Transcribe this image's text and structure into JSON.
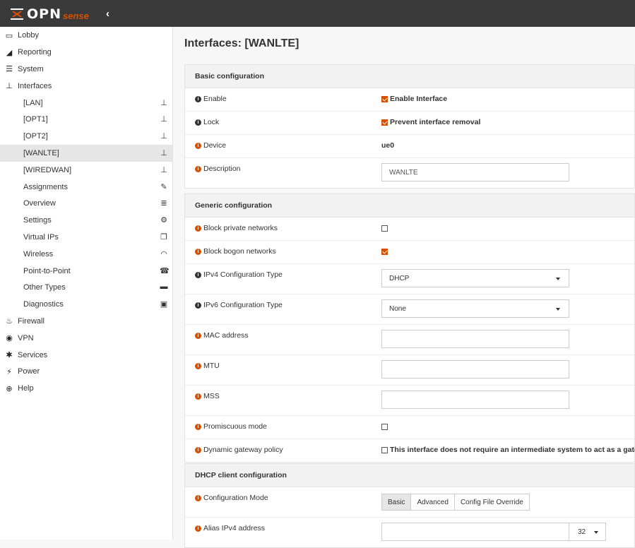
{
  "brand": {
    "opn": "OPN",
    "sense": "sense",
    "collapse": "‹"
  },
  "sidebar": {
    "items": [
      {
        "label": "Lobby",
        "icon": "laptop-icon"
      },
      {
        "label": "Reporting",
        "icon": "area-chart-icon"
      },
      {
        "label": "System",
        "icon": "server-icon"
      },
      {
        "label": "Interfaces",
        "icon": "sitemap-icon"
      }
    ],
    "sub": [
      {
        "label": "[LAN]",
        "icon": "sitemap-icon"
      },
      {
        "label": "[OPT1]",
        "icon": "sitemap-icon"
      },
      {
        "label": "[OPT2]",
        "icon": "sitemap-icon"
      },
      {
        "label": "[WANLTE]",
        "icon": "sitemap-icon"
      },
      {
        "label": "[WIREDWAN]",
        "icon": "sitemap-icon"
      },
      {
        "label": "Assignments",
        "icon": "pencil-icon"
      },
      {
        "label": "Overview",
        "icon": "list-icon"
      },
      {
        "label": "Settings",
        "icon": "cogs-icon"
      },
      {
        "label": "Virtual IPs",
        "icon": "clone-icon"
      },
      {
        "label": "Wireless",
        "icon": "wifi-icon"
      },
      {
        "label": "Point-to-Point",
        "icon": "phone-icon"
      },
      {
        "label": "Other Types",
        "icon": "archive-icon"
      },
      {
        "label": "Diagnostics",
        "icon": "medkit-icon"
      }
    ],
    "bottom": [
      {
        "label": "Firewall",
        "icon": "fire-icon"
      },
      {
        "label": "VPN",
        "icon": "globe-icon"
      },
      {
        "label": "Services",
        "icon": "cog-icon"
      },
      {
        "label": "Power",
        "icon": "plug-icon"
      },
      {
        "label": "Help",
        "icon": "support-icon"
      }
    ]
  },
  "page": {
    "title": "Interfaces: [WANLTE]"
  },
  "basic": {
    "head": "Basic configuration",
    "enable_label": "Enable",
    "enable_text": "Enable Interface",
    "lock_label": "Lock",
    "lock_text": "Prevent interface removal",
    "device_label": "Device",
    "device_value": "ue0",
    "description_label": "Description",
    "description_value": "WANLTE"
  },
  "generic": {
    "head": "Generic configuration",
    "block_private_label": "Block private networks",
    "block_bogon_label": "Block bogon networks",
    "ipv4_label": "IPv4 Configuration Type",
    "ipv4_value": "DHCP",
    "ipv6_label": "IPv6 Configuration Type",
    "ipv6_value": "None",
    "mac_label": "MAC address",
    "mtu_label": "MTU",
    "mss_label": "MSS",
    "promisc_label": "Promiscuous mode",
    "dyn_gw_label": "Dynamic gateway policy",
    "dyn_gw_text": "This interface does not require an intermediate system to act as a gateway"
  },
  "dhcp": {
    "head": "DHCP client configuration",
    "mode_label": "Configuration Mode",
    "tab_basic": "Basic",
    "tab_advanced": "Advanced",
    "tab_override": "Config File Override",
    "alias_label": "Alias IPv4 address",
    "alias_prefix": "32"
  },
  "colors": {
    "accent": "#d94f00",
    "topbar": "#3a3a3a"
  }
}
